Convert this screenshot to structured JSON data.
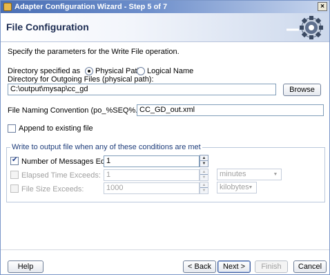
{
  "window": {
    "title": "Adapter Configuration Wizard - Step 5 of 7",
    "close_glyph": "×"
  },
  "header": {
    "page_title": "File Configuration",
    "icon": "gear-icon"
  },
  "description": "Specify the parameters for the Write File operation.",
  "directory_spec": {
    "label": "Directory specified as",
    "options": [
      "Physical Path",
      "Logical Name"
    ],
    "selected": "Physical Path"
  },
  "outgoing_dir": {
    "label": "Directory for Outgoing Files (physical path):",
    "value": "C:\\output\\mysap\\cc_gd",
    "browse_label": "Browse"
  },
  "naming": {
    "label": "File Naming Convention (po_%SEQ%.txt):",
    "value": "CC_GD_out.xml"
  },
  "append": {
    "label": "Append to existing file",
    "checked": false
  },
  "conditions": {
    "legend": "Write to output file when any of these conditions are met",
    "messages": {
      "label": "Number of Messages Equals:",
      "checked": true,
      "value": "1"
    },
    "elapsed": {
      "label": "Elapsed Time Exceeds:",
      "checked": false,
      "value": "1",
      "unit": "minutes"
    },
    "filesize": {
      "label": "File Size Exceeds:",
      "checked": false,
      "value": "1000",
      "unit": "kilobytes"
    }
  },
  "footer": {
    "help": "Help",
    "back": "< Back",
    "next": "Next >",
    "finish": "Finish",
    "cancel": "Cancel"
  }
}
